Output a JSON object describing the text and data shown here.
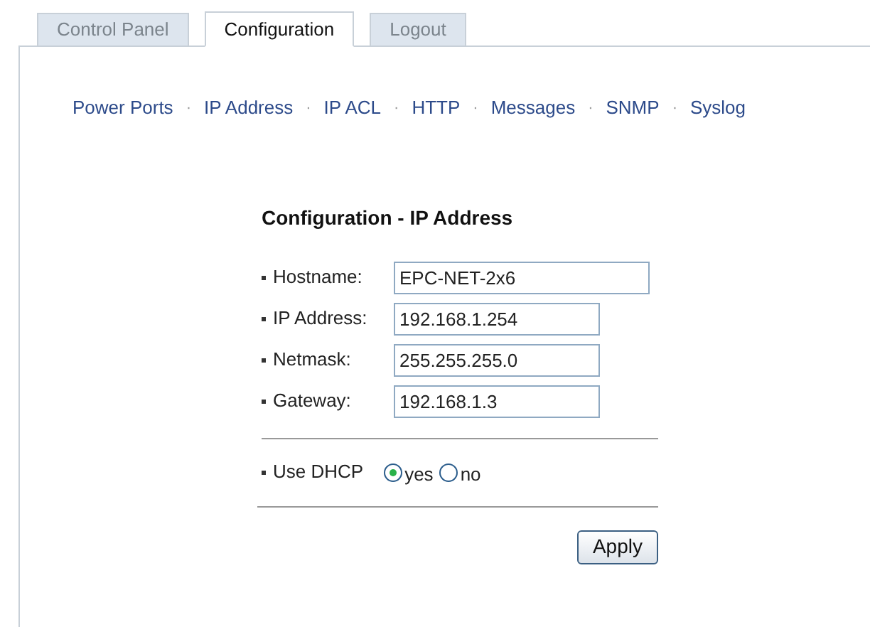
{
  "tabs": [
    {
      "label": "Control Panel",
      "selected": false
    },
    {
      "label": "Configuration",
      "selected": true
    },
    {
      "label": "Logout",
      "selected": false
    }
  ],
  "nav": {
    "separator": "·",
    "links": [
      "Power Ports",
      "IP Address",
      "IP ACL",
      "HTTP",
      "Messages",
      "SNMP",
      "Syslog"
    ]
  },
  "form": {
    "title": "Configuration - IP Address",
    "fields": [
      {
        "label": "Hostname:",
        "value": "EPC-NET-2x6",
        "wide": true
      },
      {
        "label": "IP Address:",
        "value": "192.168.1.254",
        "wide": false
      },
      {
        "label": "Netmask:",
        "value": "255.255.255.0",
        "wide": false
      },
      {
        "label": "Gateway:",
        "value": "192.168.1.3",
        "wide": false
      }
    ],
    "dhcp": {
      "label": "Use DHCP",
      "options": [
        {
          "label": "yes",
          "selected": true
        },
        {
          "label": "no",
          "selected": false
        }
      ]
    },
    "apply": "Apply"
  }
}
